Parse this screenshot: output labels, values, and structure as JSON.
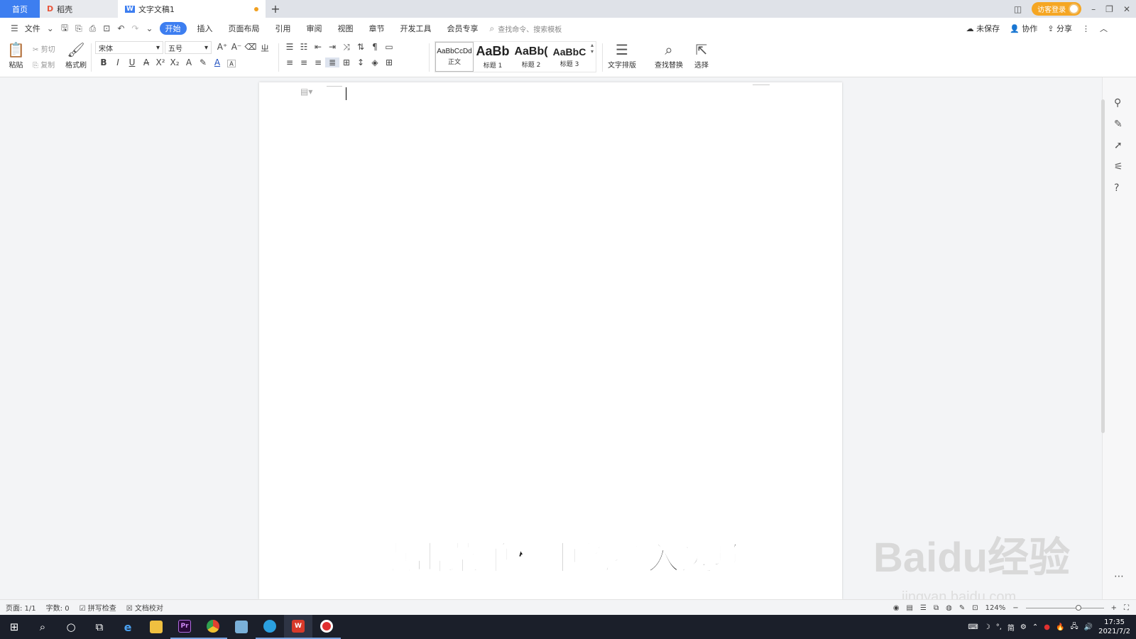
{
  "tabs": {
    "home": "首页",
    "daoke": "稻壳",
    "doc": "文字文稿1",
    "new_tab": "+"
  },
  "titlebar": {
    "login": "访客登录",
    "minimize": "–",
    "restore": "❐",
    "close": "✕"
  },
  "menu": {
    "file": "文件",
    "items": [
      "开始",
      "插入",
      "页面布局",
      "引用",
      "审阅",
      "视图",
      "章节",
      "开发工具",
      "会员专享"
    ],
    "search_placeholder": "查找命令、搜索模板",
    "unsaved": "未保存",
    "collab": "协作",
    "share": "分享"
  },
  "ribbon": {
    "paste": "粘贴",
    "cut": "剪切",
    "copy": "复制",
    "format_painter": "格式刷",
    "font_name": "宋体",
    "font_size": "五号",
    "styles": [
      {
        "sample": "AaBbCcDd",
        "label": "正文"
      },
      {
        "sample": "AaBb",
        "label": "标题 1"
      },
      {
        "sample": "AaBb(",
        "label": "标题 2"
      },
      {
        "sample": "AaBbC",
        "label": "标题 3"
      }
    ],
    "text_layout": "文字排版",
    "find_replace": "查找替换",
    "select": "选择"
  },
  "subtitle": "点击菜单栏中的插入选项",
  "watermark": {
    "brand": "Baidu经验",
    "url": "jingyan.baidu.com"
  },
  "statusbar": {
    "page": "页面: 1/1",
    "words": "字数: 0",
    "spellcheck": "拼写检查",
    "proofread": "文档校对",
    "zoom": "124%"
  },
  "taskbar": {
    "ime": "简",
    "time": "17:35",
    "date": "2021/7/2"
  },
  "colors": {
    "accent": "#3d7ef0",
    "login": "#f5a623",
    "taskbar": "#1b1f2a"
  }
}
